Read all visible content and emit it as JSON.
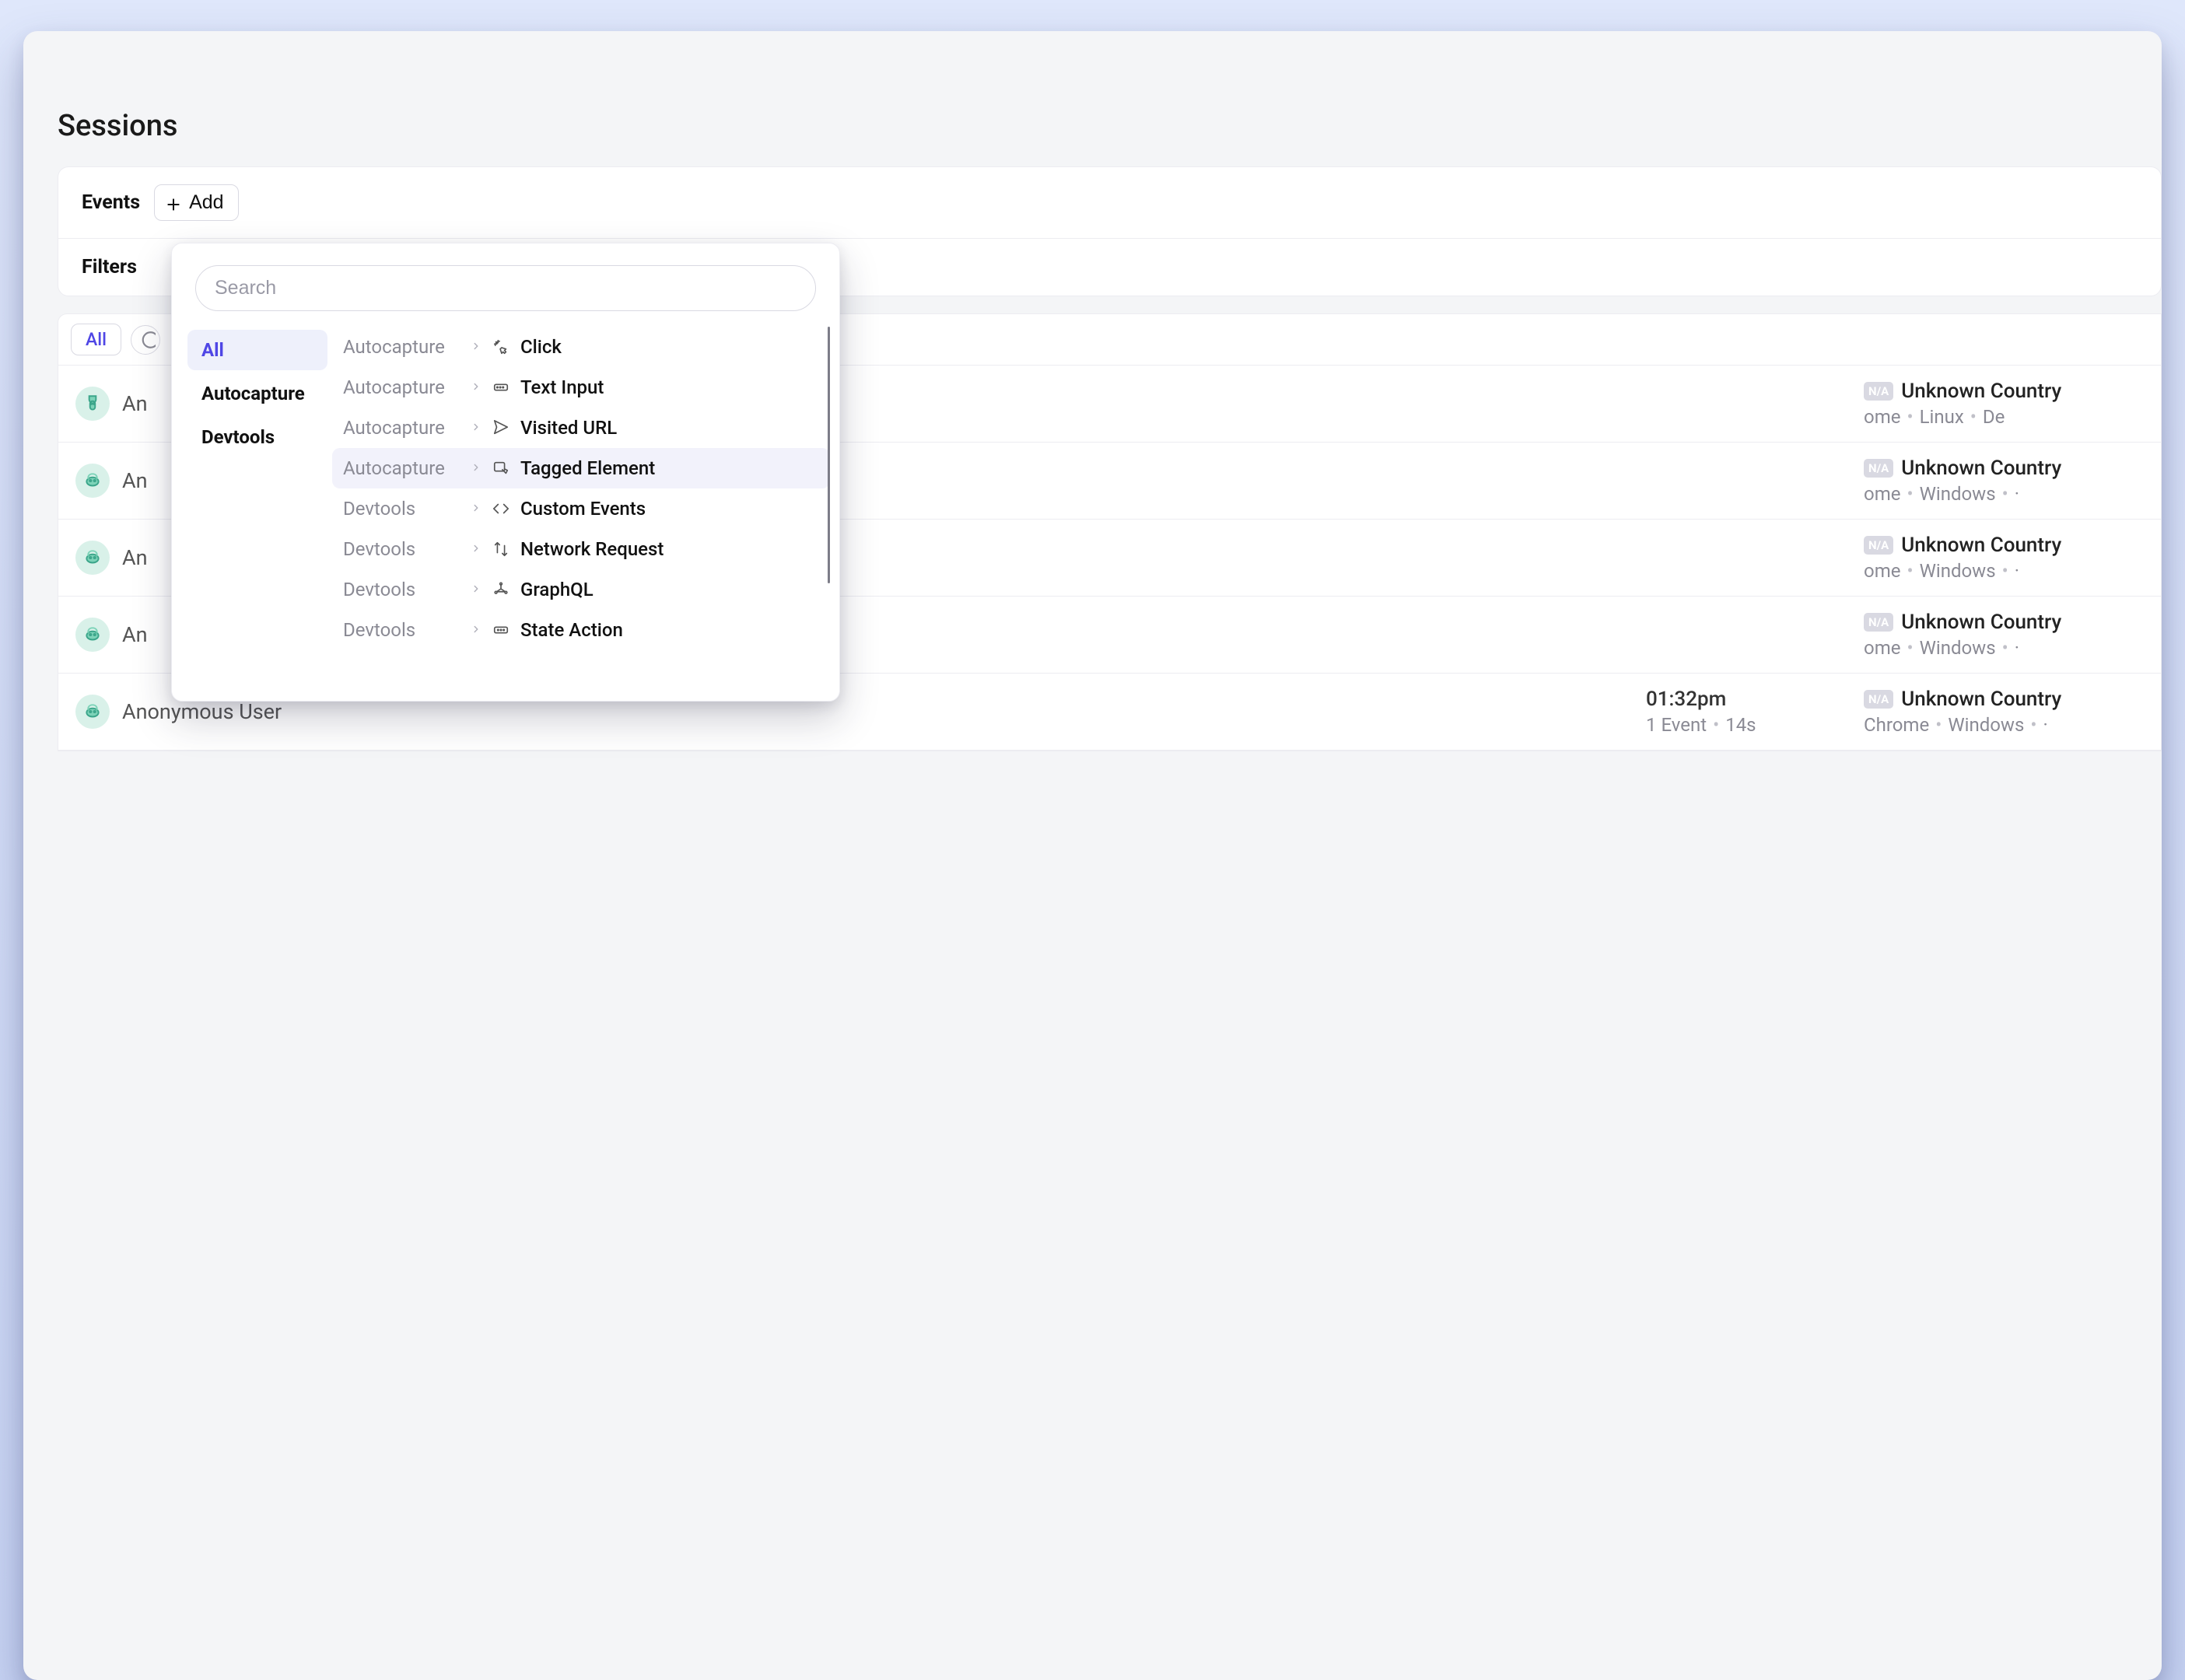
{
  "page": {
    "title": "Sessions"
  },
  "toolbar": {
    "events_label": "Events",
    "add_label": "Add",
    "filters_label": "Filters"
  },
  "filter_tabs": {
    "all_label": "All"
  },
  "sessions": [
    {
      "user_prefix": "An",
      "country": "Unknown Country",
      "browser_suffix": "ome",
      "os": "Linux",
      "extra_suffix": "De",
      "avatar_variant": "a"
    },
    {
      "user_prefix": "An",
      "country": "Unknown Country",
      "browser_suffix": "ome",
      "os": "Windows",
      "extra_suffix": "·",
      "avatar_variant": "b"
    },
    {
      "user_prefix": "An",
      "country": "Unknown Country",
      "browser_suffix": "ome",
      "os": "Windows",
      "extra_suffix": "·",
      "avatar_variant": "b"
    },
    {
      "user_prefix": "An",
      "country": "Unknown Country",
      "browser_suffix": "ome",
      "os": "Windows",
      "extra_suffix": "·",
      "avatar_variant": "b"
    },
    {
      "user_full": "Anonymous User",
      "time": "01:32pm",
      "events": "1 Event",
      "duration": "14s",
      "country": "Unknown Country",
      "browser": "Chrome",
      "os": "Windows",
      "extra_suffix": "·",
      "avatar_variant": "b"
    }
  ],
  "popover": {
    "search_placeholder": "Search",
    "categories": [
      {
        "label": "All",
        "active": true
      },
      {
        "label": "Autocapture",
        "active": false
      },
      {
        "label": "Devtools",
        "active": false
      }
    ],
    "events": [
      {
        "category": "Autocapture",
        "label": "Click",
        "icon": "click-icon"
      },
      {
        "category": "Autocapture",
        "label": "Text Input",
        "icon": "text-input-icon"
      },
      {
        "category": "Autocapture",
        "label": "Visited URL",
        "icon": "visited-url-icon"
      },
      {
        "category": "Autocapture",
        "label": "Tagged Element",
        "icon": "tagged-element-icon",
        "hover": true
      },
      {
        "category": "Devtools",
        "label": "Custom Events",
        "icon": "code-icon"
      },
      {
        "category": "Devtools",
        "label": "Network Request",
        "icon": "network-icon"
      },
      {
        "category": "Devtools",
        "label": "GraphQL",
        "icon": "graphql-icon"
      },
      {
        "category": "Devtools",
        "label": "State Action",
        "icon": "state-action-icon"
      }
    ]
  },
  "badges": {
    "na": "N/A"
  }
}
